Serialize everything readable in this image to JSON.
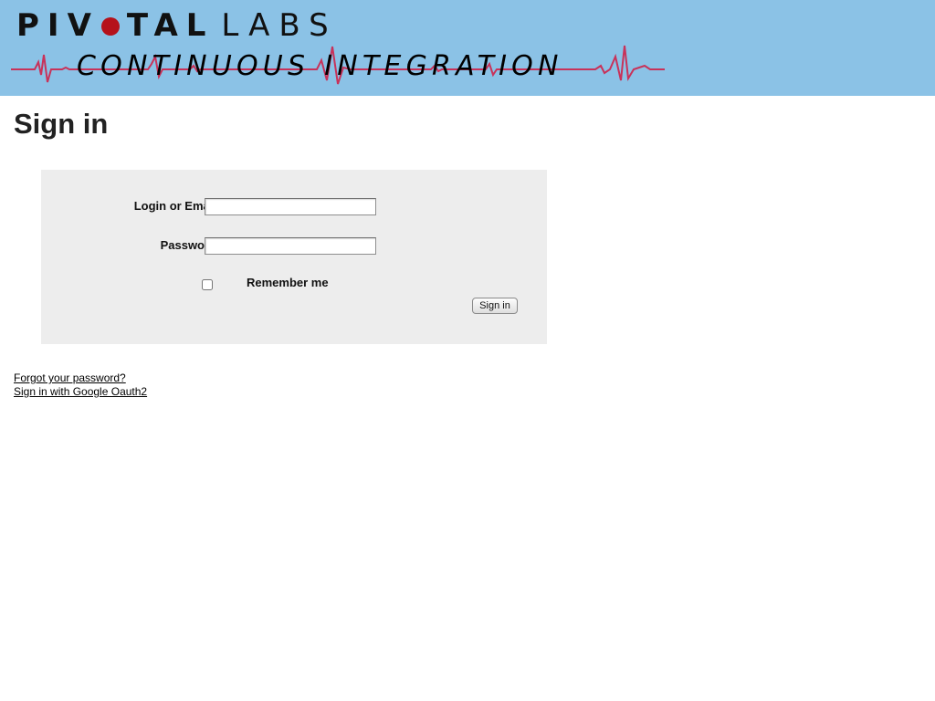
{
  "header": {
    "brand_left": "PIV",
    "brand_mid": "TAL",
    "brand_right": "LABS",
    "subtitle_word1": "CONTINUOUS",
    "subtitle_word2": "INTEGRATION",
    "background_color": "#8bc2e6",
    "pulse_color": "#c8325a",
    "dot_color": "#b5121b"
  },
  "page": {
    "title": "Sign in"
  },
  "form": {
    "login_label": "Login or Email",
    "login_value": "",
    "password_label": "Password",
    "password_value": "",
    "remember_label": "Remember me",
    "remember_checked": false,
    "submit_label": "Sign in"
  },
  "links": {
    "forgot_password": "Forgot your password?",
    "google_oauth": "Sign in with Google Oauth2"
  }
}
